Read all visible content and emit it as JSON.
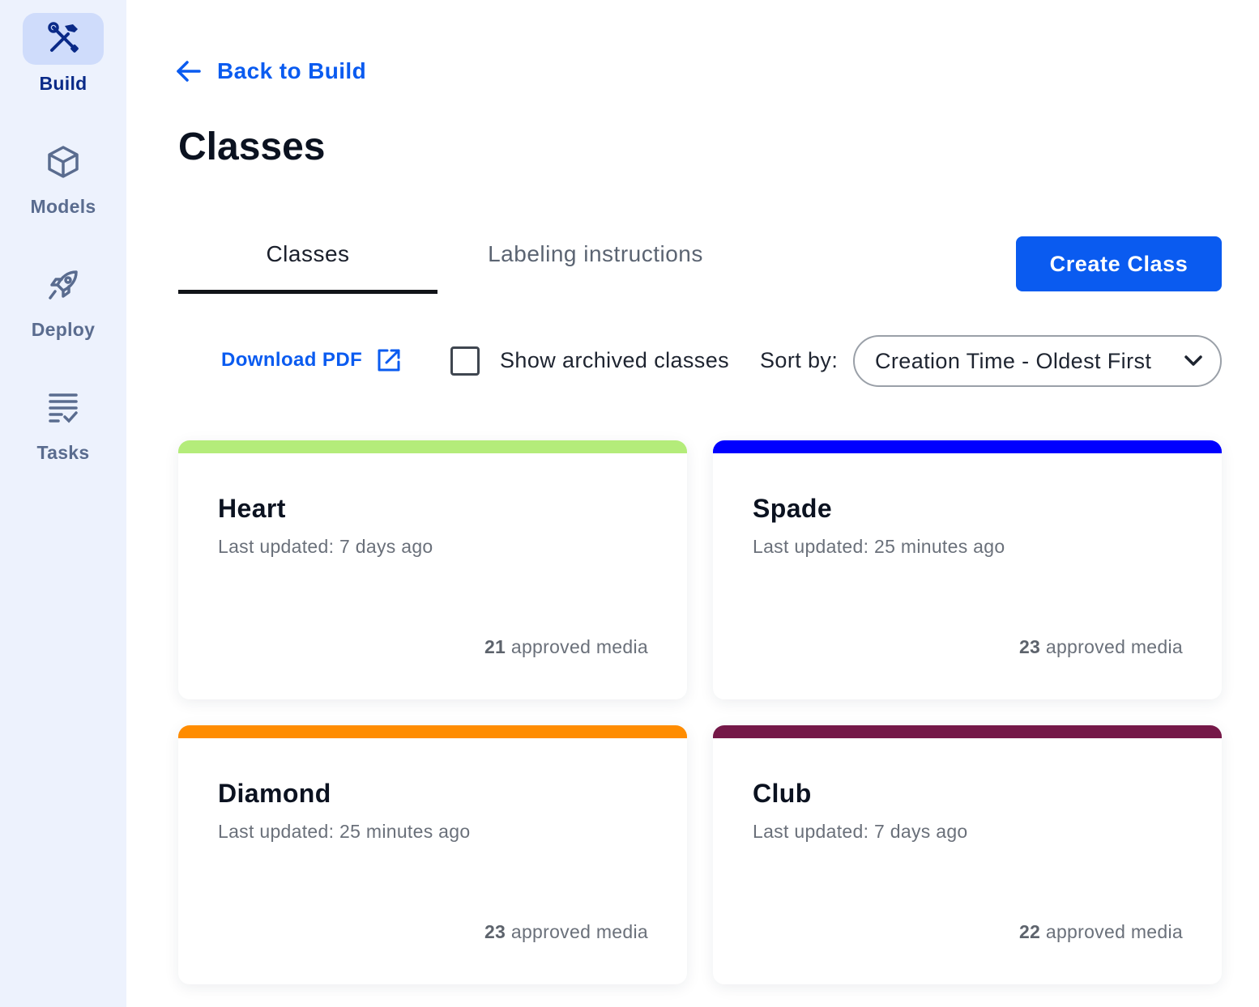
{
  "sidebar": {
    "items": [
      {
        "label": "Build",
        "icon": "build-tools-icon",
        "active": true
      },
      {
        "label": "Models",
        "icon": "cube-icon",
        "active": false
      },
      {
        "label": "Deploy",
        "icon": "rocket-icon",
        "active": false
      },
      {
        "label": "Tasks",
        "icon": "task-list-icon",
        "active": false
      }
    ]
  },
  "header": {
    "back_label": "Back to Build",
    "title": "Classes"
  },
  "tabs": [
    {
      "label": "Classes",
      "active": true
    },
    {
      "label": "Labeling instructions",
      "active": false
    }
  ],
  "actions": {
    "create_label": "Create Class"
  },
  "toolbar": {
    "download_label": "Download PDF",
    "show_archived_label": "Show archived classes",
    "show_archived_checked": false,
    "sort_label": "Sort by:",
    "sort_value": "Creation Time - Oldest First"
  },
  "cards": [
    {
      "name": "Heart",
      "updated": "Last updated: 7 days ago",
      "count": "21",
      "media_suffix": " approved media",
      "color": "#b4ec7a"
    },
    {
      "name": "Spade",
      "updated": "Last updated: 25 minutes ago",
      "count": "23",
      "media_suffix": " approved media",
      "color": "#0000ff"
    },
    {
      "name": "Diamond",
      "updated": "Last updated: 25 minutes ago",
      "count": "23",
      "media_suffix": " approved media",
      "color": "#ff8c00"
    },
    {
      "name": "Club",
      "updated": "Last updated: 7 days ago",
      "count": "22",
      "media_suffix": " approved media",
      "color": "#751848"
    }
  ],
  "colors": {
    "accent": "#0a5bf0",
    "sidebar_bg": "#edf2fd",
    "active_nav_bg": "#cfdcfb",
    "active_nav_text": "#0a2a88"
  }
}
